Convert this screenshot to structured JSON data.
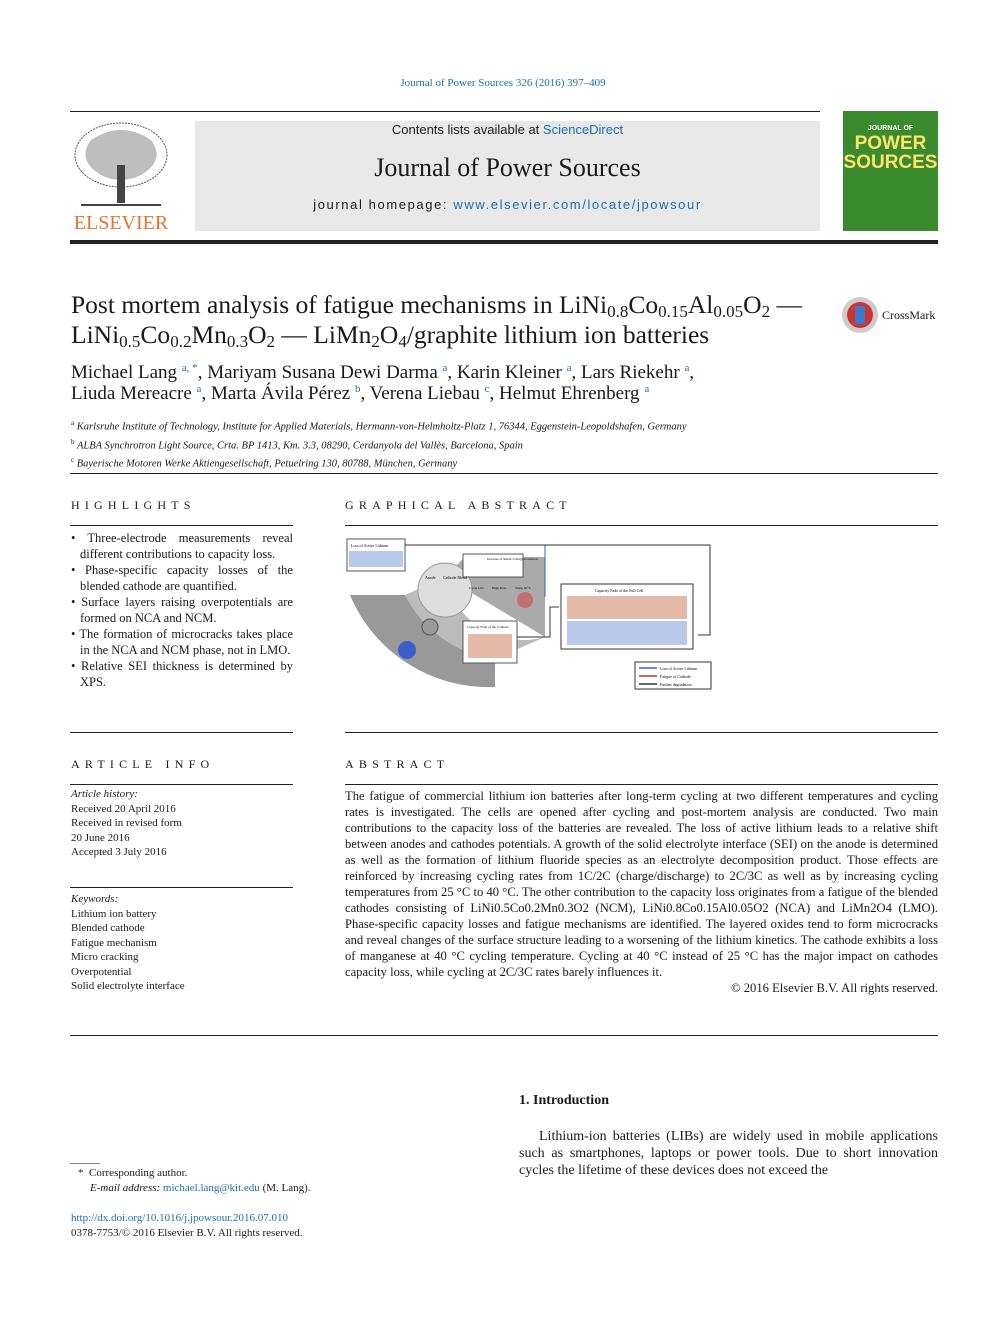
{
  "header": {
    "citation": "Journal of Power Sources 326 (2016) 397–409",
    "contents_prefix": "Contents lists available at ",
    "contents_link": "ScienceDirect",
    "journal_title": "Journal of Power Sources",
    "homepage_prefix": "journal homepage: ",
    "homepage_link": "www.elsevier.com/locate/jpowsour",
    "publisher": "ELSEVIER",
    "cover_text_top": "JOURNAL OF",
    "cover_text_main": "POWER SOURCES"
  },
  "article": {
    "title_line1": "Post mortem analysis of fatigue mechanisms in LiNi0.8Co0.15Al0.05O2 —",
    "title_line2": "LiNi0.5Co0.2Mn0.3O2 — LiMn2O4/graphite lithium ion batteries",
    "crossmark": "CrossMark",
    "authors": [
      {
        "name": "Michael Lang",
        "aff": "a, *"
      },
      {
        "name": "Mariyam Susana Dewi Darma",
        "aff": "a"
      },
      {
        "name": "Karin Kleiner",
        "aff": "a"
      },
      {
        "name": "Lars Riekehr",
        "aff": "a"
      },
      {
        "name": "Liuda Mereacre",
        "aff": "a"
      },
      {
        "name": "Marta Ávila Pérez",
        "aff": "b"
      },
      {
        "name": "Verena Liebau",
        "aff": "c"
      },
      {
        "name": "Helmut Ehrenberg",
        "aff": "a"
      }
    ],
    "affiliations": [
      {
        "mark": "a",
        "text": "Karlsruhe Institute of Technology, Institute for Applied Materials, Hermann-von-Helmholtz-Platz 1, 76344, Eggenstein-Leopoldshafen, Germany"
      },
      {
        "mark": "b",
        "text": "ALBA Synchrotron Light Source, Crta. BP 1413, Km. 3.3, 08290, Cerdanyola del Vallès, Barcelona, Spain"
      },
      {
        "mark": "c",
        "text": "Bayerische Motoren Werke Aktiengesellschaft, Petuelring 130, 80788, München, Germany"
      }
    ]
  },
  "highlights": {
    "heading": "HIGHLIGHTS",
    "items": [
      "Three-electrode measurements reveal different contributions to capacity loss.",
      "Phase-specific capacity losses of the blended cathode are quantified.",
      "Surface layers raising overpotentials are formed on NCA and NCM.",
      "The formation of microcracks takes place in the NCA and NCM phase, not in LMO.",
      "Relative SEI thickness is determined by XPS."
    ]
  },
  "graphical_abstract": {
    "heading": "GRAPHICAL ABSTRACT",
    "labels": {
      "loss_active_li": "Loss of Active Lithium",
      "increase_potentials": "Increase of Relax./Charge Potentials",
      "anode": "Anode",
      "cathode_blend": "Cathode Blend",
      "cycle_life": "Cycle Life",
      "high_rate": "High Rate",
      "temp": "Temp 40°C",
      "cap_fade_cathode": "Capacity Fade of the Cathode",
      "cap_fade_full": "Capacity Fade of the Full Cell"
    },
    "legend": [
      "Loss of Active Lithium",
      "Fatigue of Cathode",
      "Further degradation"
    ],
    "colors": {
      "lithium": "#3a5fcd",
      "cathode": "#b8322a",
      "other": "#333333"
    }
  },
  "article_info": {
    "heading": "ARTICLE INFO",
    "history_label": "Article history:",
    "history": [
      "Received 20 April 2016",
      "Received in revised form",
      "20 June 2016",
      "Accepted 3 July 2016"
    ],
    "keywords_label": "Keywords:",
    "keywords": [
      "Lithium ion battery",
      "Blended cathode",
      "Fatigue mechanism",
      "Micro cracking",
      "Overpotential",
      "Solid electrolyte interface"
    ]
  },
  "abstract": {
    "heading": "ABSTRACT",
    "text": "The fatigue of commercial lithium ion batteries after long-term cycling at two different temperatures and cycling rates is investigated. The cells are opened after cycling and post-mortem analysis are conducted. Two main contributions to the capacity loss of the batteries are revealed. The loss of active lithium leads to a relative shift between anodes and cathodes potentials. A growth of the solid electrolyte interface (SEI) on the anode is determined as well as the formation of lithium fluoride species as an electrolyte decomposition product. Those effects are reinforced by increasing cycling rates from 1C/2C (charge/discharge) to 2C/3C as well as by increasing cycling temperatures from 25 °C to 40 °C. The other contribution to the capacity loss originates from a fatigue of the blended cathodes consisting of LiNi0.5Co0.2Mn0.3O2 (NCM), LiNi0.8Co0.15Al0.05O2 (NCA) and LiMn2O4 (LMO). Phase-specific capacity losses and fatigue mechanisms are identified. The layered oxides tend to form microcracks and reveal changes of the surface structure leading to a worsening of the lithium kinetics. The cathode exhibits a loss of manganese at 40 °C cycling temperature. Cycling at 40 °C instead of 25 °C has the major impact on cathodes capacity loss, while cycling at 2C/3C rates barely influences it.",
    "copyright": "© 2016 Elsevier B.V. All rights reserved."
  },
  "introduction": {
    "heading": "1.  Introduction",
    "text": "Lithium-ion batteries (LIBs) are widely used in mobile applications such as smartphones, laptops or power tools. Due to short innovation cycles the lifetime of these devices does not exceed the"
  },
  "footnote": {
    "mark": "*",
    "corresponding": "Corresponding author.",
    "email_label": "E-mail address: ",
    "email": "michael.lang@kit.edu",
    "email_suffix": " (M. Lang).",
    "doi": "http://dx.doi.org/10.1016/j.jpowsour.2016.07.010",
    "issn": "0378-7753/© 2016 Elsevier B.V. All rights reserved."
  }
}
